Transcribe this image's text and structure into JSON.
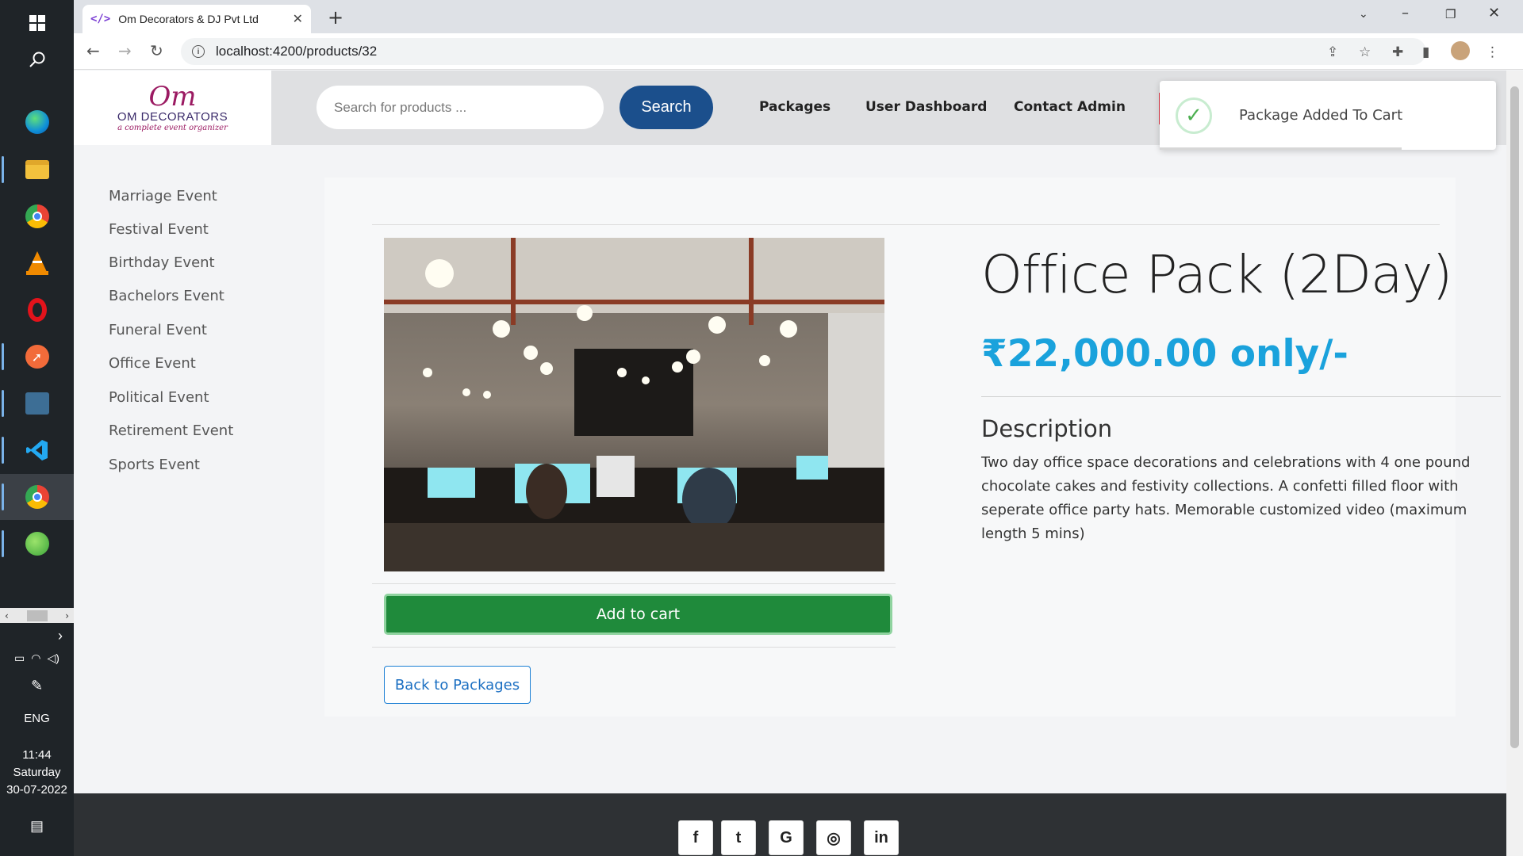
{
  "taskbar": {
    "apps": [
      "windows-start",
      "search",
      "edge",
      "file-explorer",
      "chrome",
      "vlc",
      "opera",
      "postman",
      "mysql-workbench",
      "vscode",
      "chrome-profile",
      "spring-tools"
    ],
    "language": "ENG",
    "time": "11:44",
    "day": "Saturday",
    "date": "30-07-2022"
  },
  "browser": {
    "tab_title": "Om Decorators & DJ Pvt Ltd",
    "tab_favicon": "</>",
    "url": "localhost:4200/products/32"
  },
  "header": {
    "logo_mark": "Om",
    "logo_name": "OM DECORATORS",
    "logo_tagline": "a complete event organizer",
    "search_placeholder": "Search for products ...",
    "search_button": "Search",
    "nav": [
      "Packages",
      "User Dashboard",
      "Contact Admin"
    ]
  },
  "toast": {
    "message": "Package Added To Cart",
    "icon": "check-icon",
    "progress": 0.72
  },
  "categories": [
    "Marriage Event",
    "Festival Event",
    "Birthday Event",
    "Bachelors Event",
    "Funeral Event",
    "Office Event",
    "Political Event",
    "Retirement Event",
    "Sports Event"
  ],
  "product": {
    "title": "Office Pack (2Day)",
    "price": "₹22,000.00 only/-",
    "description_heading": "Description",
    "description": "Two day office space decorations and celebrations with 4 one pound chocolate cakes and festivity collections. A confetti filled floor with seperate office party hats. Memorable customized video (maximum length 5 mins)",
    "add_to_cart": "Add to cart",
    "back_button": "Back to Packages"
  },
  "footer": {
    "social": [
      {
        "name": "facebook",
        "glyph": "f"
      },
      {
        "name": "twitter",
        "glyph": "t"
      },
      {
        "name": "google",
        "glyph": "G"
      },
      {
        "name": "instagram",
        "glyph": "◎"
      },
      {
        "name": "linkedin",
        "glyph": "in"
      }
    ]
  },
  "colors": {
    "search_button": "#1b4f8c",
    "add_to_cart": "#1f8a3b",
    "price": "#1aa2dc",
    "footer": "#2e3134"
  }
}
